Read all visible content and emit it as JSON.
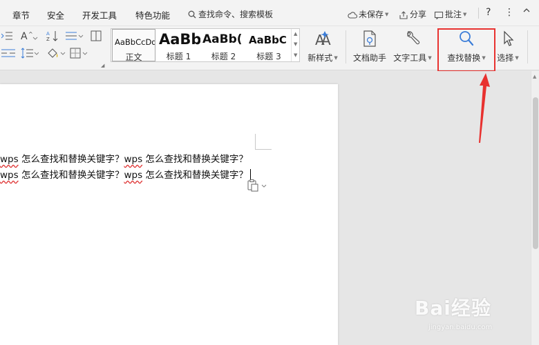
{
  "menu": {
    "items": [
      "章节",
      "安全",
      "开发工具",
      "特色功能"
    ],
    "search_placeholder": "查找命令、搜索模板",
    "unsaved": "未保存",
    "share": "分享",
    "comment": "批注",
    "help": "?",
    "more": "⋮"
  },
  "ribbon": {
    "styles": [
      {
        "sample": "AaBbCcDd",
        "name": "正文"
      },
      {
        "sample": "AaBb",
        "name": "标题 1"
      },
      {
        "sample": "AaBb(",
        "name": "标题 2"
      },
      {
        "sample": "AaBbC",
        "name": "标题 3"
      }
    ],
    "new_style": "新样式",
    "doc_helper": "文档助手",
    "text_tools": "文字工具",
    "find_replace": "查找替换",
    "select": "选择"
  },
  "document": {
    "line1": [
      {
        "word": "wps",
        "text": " 怎么查找和替换关键字？"
      },
      {
        "word": "wps",
        "text": " 怎么查找和替换关键字？"
      }
    ],
    "line2": [
      {
        "word": "wps",
        "text": " 怎么查找和替换关键字？"
      },
      {
        "word": "wps",
        "text": " 怎么查找和替换关键字？"
      }
    ]
  },
  "watermark": {
    "main": "Bai经验",
    "sub": "jingyan.baidu.com"
  },
  "colors": {
    "highlight": "#e8312f",
    "arrow": "#e8312f",
    "find_icon": "#3b7dd8"
  }
}
